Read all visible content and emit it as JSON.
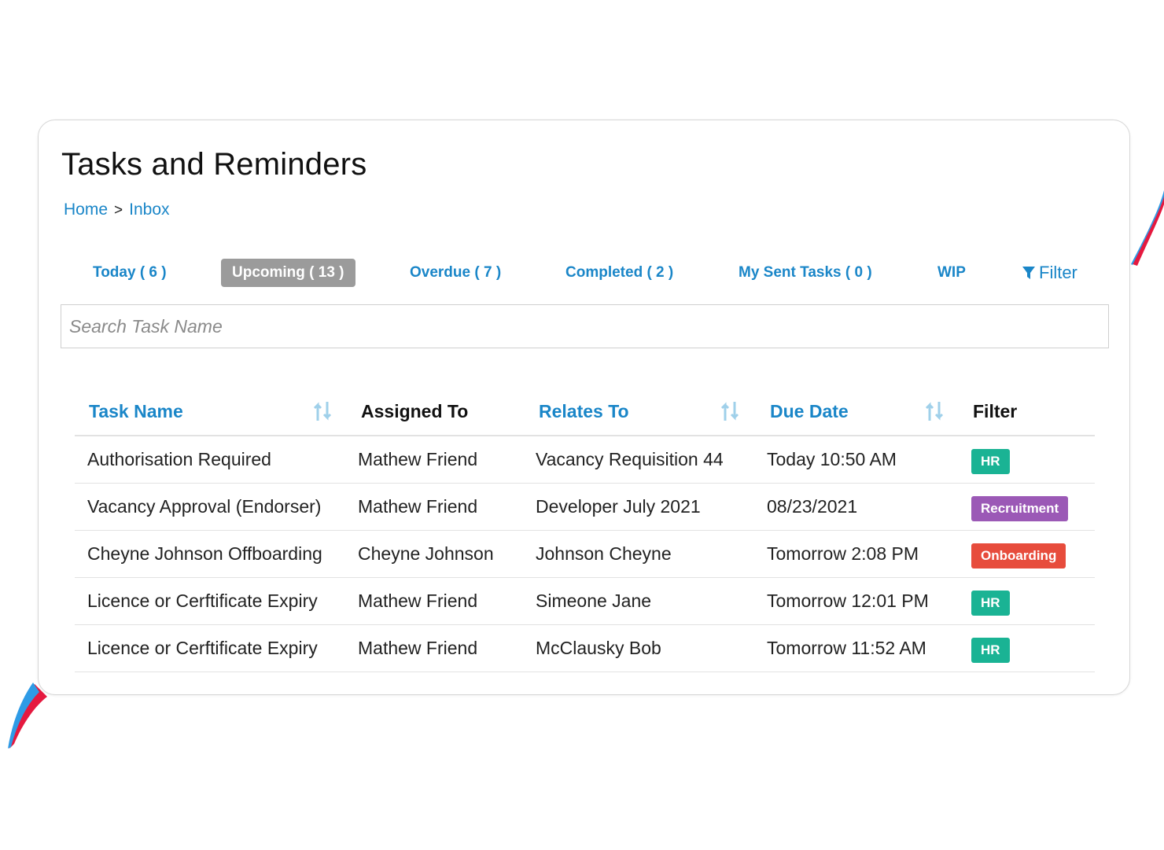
{
  "colors": {
    "accent": "#1a86c8",
    "active_tab_bg": "#9b9b9b",
    "due_today": "#2e8b2e",
    "due_other": "#8a8a8a",
    "badge_hr": "#1ab394",
    "badge_recruitment": "#9b59b6",
    "badge_onboarding": "#e74c3c",
    "deco_blue": "#2e9be6",
    "deco_red": "#e5193f"
  },
  "header": {
    "title": "Tasks and Reminders",
    "breadcrumb": {
      "home": "Home",
      "separator": ">",
      "current": "Inbox"
    }
  },
  "tabs": [
    {
      "label": "Today ( 6 )",
      "active": false
    },
    {
      "label": "Upcoming ( 13 )",
      "active": true
    },
    {
      "label": "Overdue ( 7 )",
      "active": false
    },
    {
      "label": "Completed ( 2 )",
      "active": false
    },
    {
      "label": "My Sent Tasks ( 0 )",
      "active": false
    },
    {
      "label": "WIP",
      "active": false
    }
  ],
  "filter_button": {
    "label": "Filter",
    "icon": "filter-funnel-icon"
  },
  "search": {
    "placeholder": "Search Task Name",
    "value": ""
  },
  "table": {
    "headers": {
      "task_name": "Task Name",
      "assigned_to": "Assigned To",
      "relates_to": "Relates To",
      "due_date": "Due Date",
      "filter": "Filter"
    },
    "sort_icon": "sort-arrows-icon",
    "rows": [
      {
        "task_name": "Authorisation Required",
        "assigned_to": "Mathew Friend",
        "relates_to": "Vacancy Requisition 44",
        "due_date": "Today 10:50 AM",
        "due_today": true,
        "tag": "HR"
      },
      {
        "task_name": "Vacancy Approval (Endorser)",
        "assigned_to": "Mathew Friend",
        "relates_to": "Developer July 2021",
        "due_date": "08/23/2021",
        "due_today": false,
        "tag": "Recruitment"
      },
      {
        "task_name": "Cheyne Johnson Offboarding",
        "assigned_to": "Cheyne Johnson",
        "relates_to": "Johnson Cheyne",
        "due_date": "Tomorrow 2:08 PM",
        "due_today": false,
        "tag": "Onboarding"
      },
      {
        "task_name": "Licence or Cerftificate Expiry",
        "assigned_to": "Mathew Friend",
        "relates_to": "Simeone Jane",
        "due_date": "Tomorrow 12:01 PM",
        "due_today": false,
        "tag": "HR"
      },
      {
        "task_name": "Licence or Cerftificate Expiry",
        "assigned_to": "Mathew Friend",
        "relates_to": "McClausky Bob",
        "due_date": "Tomorrow 11:52 AM",
        "due_today": false,
        "tag": "HR"
      }
    ]
  }
}
